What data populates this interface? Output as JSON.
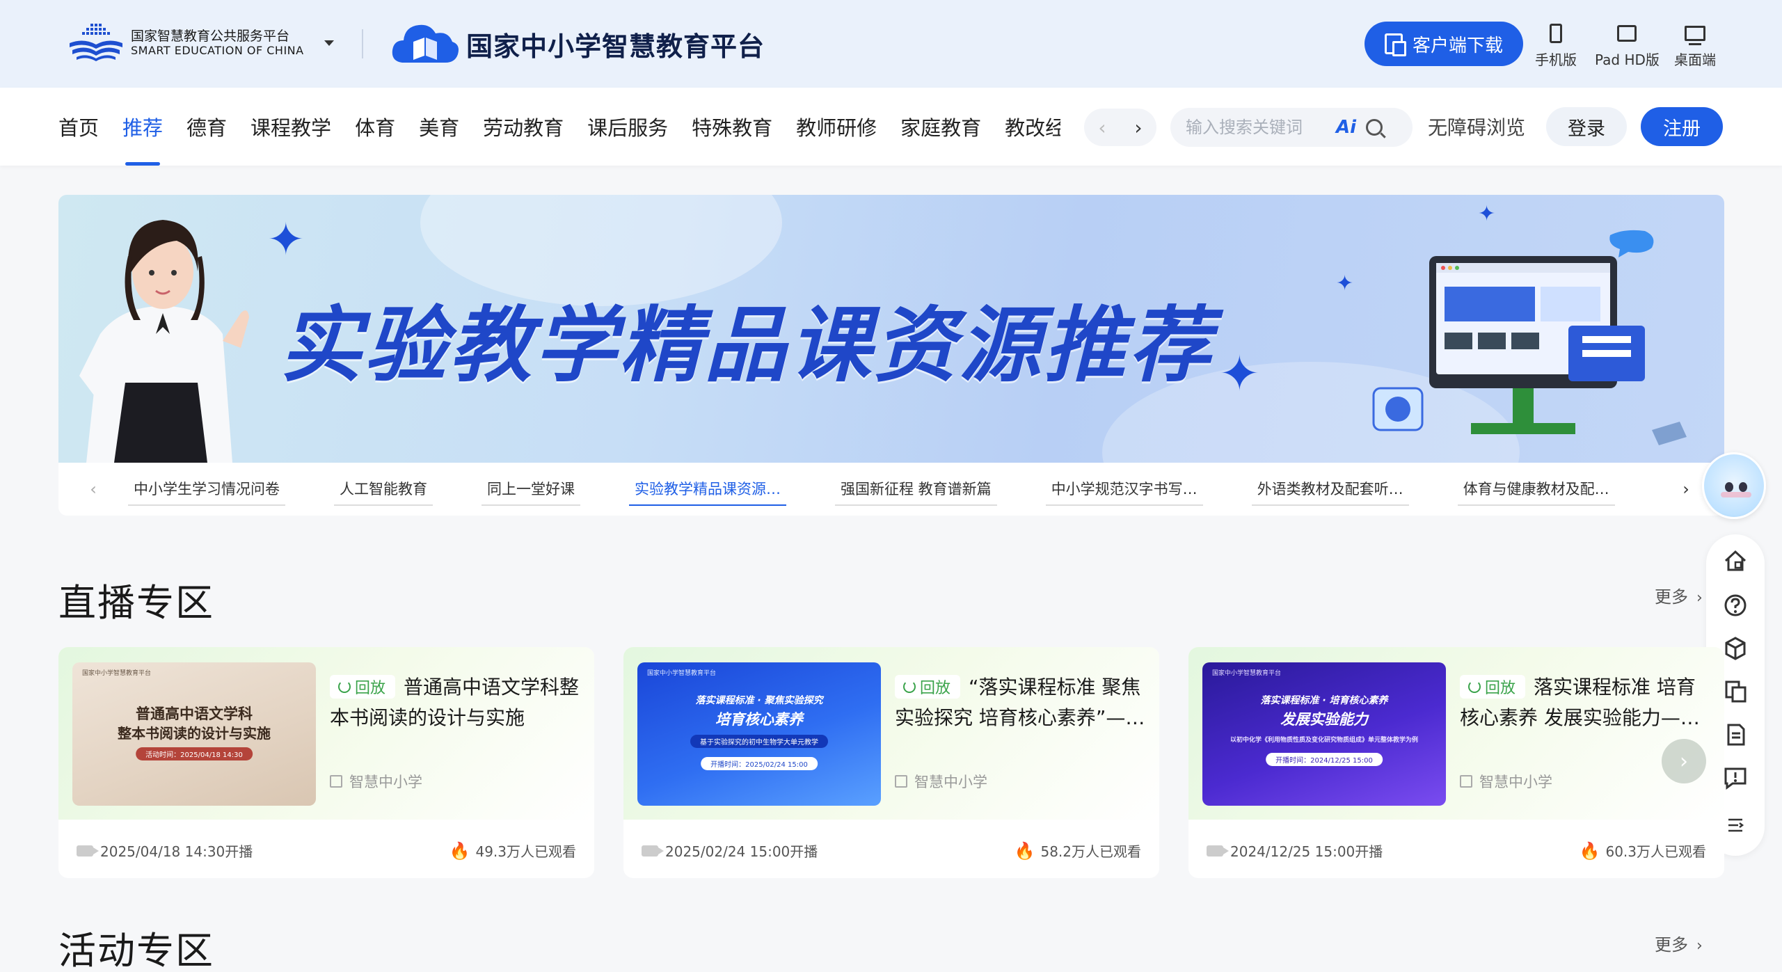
{
  "header": {
    "logo1_title": "国家智慧教育公共服务平台",
    "logo1_subtitle": "SMART EDUCATION OF CHINA",
    "logo2_title": "国家中小学智慧教育平台",
    "download_label": "客户端下载",
    "devices": [
      {
        "label": "手机版",
        "icon": "phone-icon"
      },
      {
        "label": "Pad HD版",
        "icon": "tablet-icon"
      },
      {
        "label": "桌面端",
        "icon": "desktop-icon"
      }
    ]
  },
  "nav": {
    "items": [
      "首页",
      "推荐",
      "德育",
      "课程教学",
      "体育",
      "美育",
      "劳动教育",
      "课后服务",
      "特殊教育",
      "教师研修",
      "家庭教育",
      "教改经验"
    ],
    "active_index": 1,
    "search_placeholder": "输入搜索关键词",
    "ai_label": "Ai",
    "accessibility_label": "无障碍浏览",
    "login_label": "登录",
    "register_label": "注册"
  },
  "banner": {
    "title": "实验教学精品课资源推荐",
    "tabs": [
      "中小学生学习情况问卷",
      "人工智能教育",
      "同上一堂好课",
      "实验教学精品课资源…",
      "强国新征程 教育谱新篇",
      "中小学规范汉字书写…",
      "外语类教材及配套听…",
      "体育与健康教材及配…"
    ],
    "active_tab": 3
  },
  "live": {
    "title": "直播专区",
    "more_label": "更多",
    "cards": [
      {
        "badge": "回放",
        "title": "普通高中语文学科整本书阅读的设计与实施",
        "org": "智慧中小学",
        "time": "2025/04/18 14:30开播",
        "views": "49.3万人已观看",
        "thumb_title_1": "普通高中语文学科",
        "thumb_title_2": "整本书阅读的设计与实施",
        "thumb_time": "活动时间：2025/04/18 14:30"
      },
      {
        "badge": "回放",
        "title": "“落实课程标准 聚焦实验探究 培育核心素养”—…",
        "org": "智慧中小学",
        "time": "2025/02/24 15:00开播",
        "views": "58.2万人已观看",
        "thumb_title_1": "落实课程标准 · 聚焦实验探究",
        "thumb_title_2": "培育核心素养",
        "thumb_sub": "基于实验探究的初中生物学大单元教学",
        "thumb_time": "开播时间：2025/02/24 15:00"
      },
      {
        "badge": "回放",
        "title": "落实课程标准 培育核心素养 发展实验能力—…",
        "org": "智慧中小学",
        "time": "2024/12/25 15:00开播",
        "views": "60.3万人已观看",
        "thumb_title_1": "落实课程标准 · 培育核心素养",
        "thumb_title_2": "发展实验能力",
        "thumb_sub": "以初中化学《利用物质性质及变化研究物质组成》单元整体教学为例",
        "thumb_time": "开播时间：2024/12/25 15:00"
      }
    ]
  },
  "activity": {
    "title": "活动专区",
    "more_label": "更多"
  },
  "thumb_org_label": "国家中小学智慧教育平台",
  "colors": {
    "primary": "#1f5fe6",
    "replay_green": "#3aa34a",
    "fire": "#f04438"
  }
}
